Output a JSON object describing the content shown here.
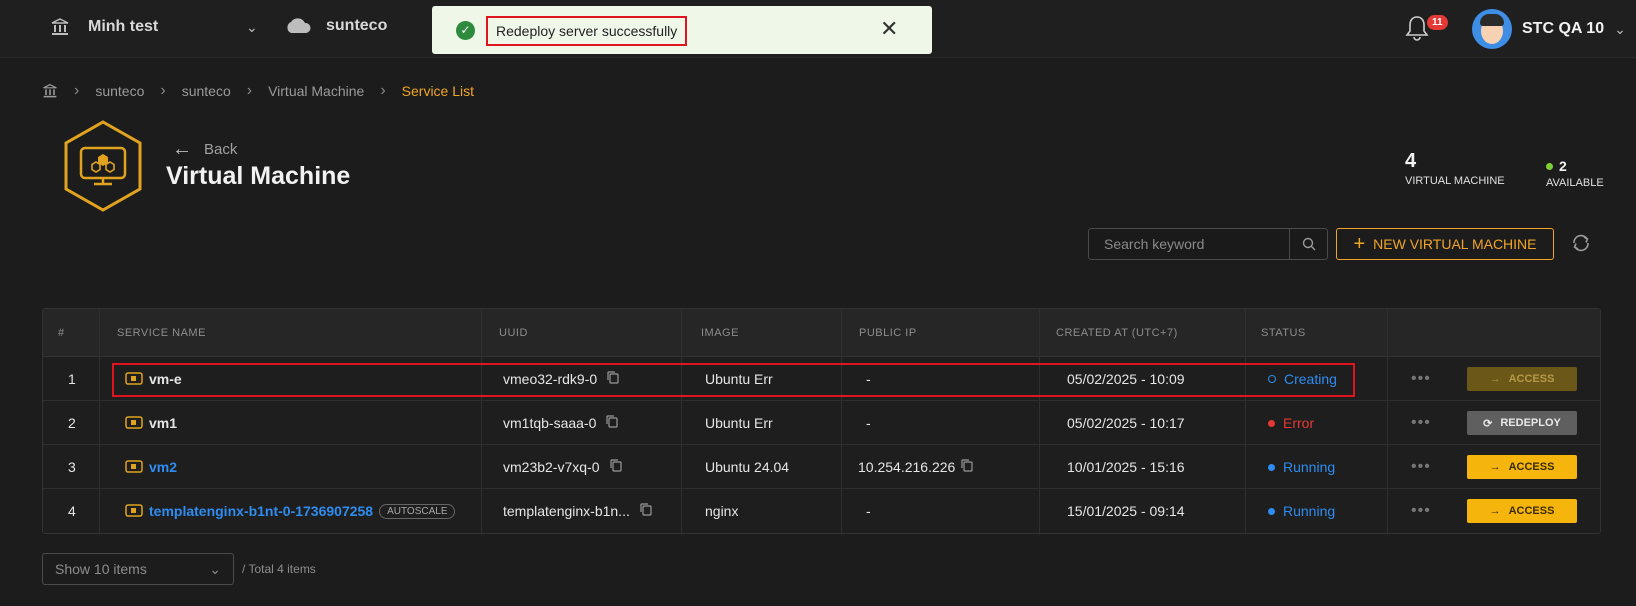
{
  "topbar": {
    "org_label": "Minh test",
    "project_label": "sunteco",
    "notification_count": "11",
    "user_name": "STC QA 10"
  },
  "toast": {
    "message": "Redeploy server successfully",
    "type": "success"
  },
  "breadcrumb": [
    "sunteco",
    "sunteco",
    "Virtual Machine",
    "Service List"
  ],
  "header": {
    "back_label": "Back",
    "title": "Virtual Machine",
    "stats": [
      {
        "value": "4",
        "label": "VIRTUAL MACHINE"
      },
      {
        "value": "2",
        "label": "AVAILABLE"
      }
    ]
  },
  "toolbar": {
    "search_placeholder": "Search keyword",
    "new_label": "NEW VIRTUAL MACHINE"
  },
  "table": {
    "columns": [
      "#",
      "SERVICE NAME",
      "UUID",
      "IMAGE",
      "PUBLIC IP",
      "CREATED AT (UTC+7)",
      "STATUS"
    ],
    "rows": [
      {
        "index": "1",
        "name": "vm-e",
        "tag": "",
        "uuid": "vmeo32-rdk9-0",
        "image": "Ubuntu Err",
        "ip": "-",
        "created": "05/02/2025 - 10:09",
        "status": "Creating",
        "action": "ACCESS"
      },
      {
        "index": "2",
        "name": "vm1",
        "tag": "",
        "uuid": "vm1tqb-saaa-0",
        "image": "Ubuntu Err",
        "ip": "-",
        "created": "05/02/2025 - 10:17",
        "status": "Error",
        "action": "REDEPLOY"
      },
      {
        "index": "3",
        "name": "vm2",
        "tag": "",
        "uuid": "vm23b2-v7xq-0",
        "image": "Ubuntu 24.04",
        "ip": "10.254.216.226",
        "created": "10/01/2025 - 15:16",
        "status": "Running",
        "action": "ACCESS"
      },
      {
        "index": "4",
        "name": "templatenginx-b1nt-0-1736907258",
        "tag": "AUTOSCALE",
        "uuid": "templatenginx-b1n...",
        "image": "nginx",
        "ip": "-",
        "created": "15/01/2025 - 09:14",
        "status": "Running",
        "action": "ACCESS"
      }
    ]
  },
  "pagination": {
    "page_size_label": "Show 10 items",
    "total_label": "/ Total 4 items"
  },
  "colors": {
    "accent": "#f0a526",
    "link": "#2f8cf0",
    "error": "#e53935",
    "success": "#2e8b3e",
    "highlight_box": "#e0141e"
  }
}
